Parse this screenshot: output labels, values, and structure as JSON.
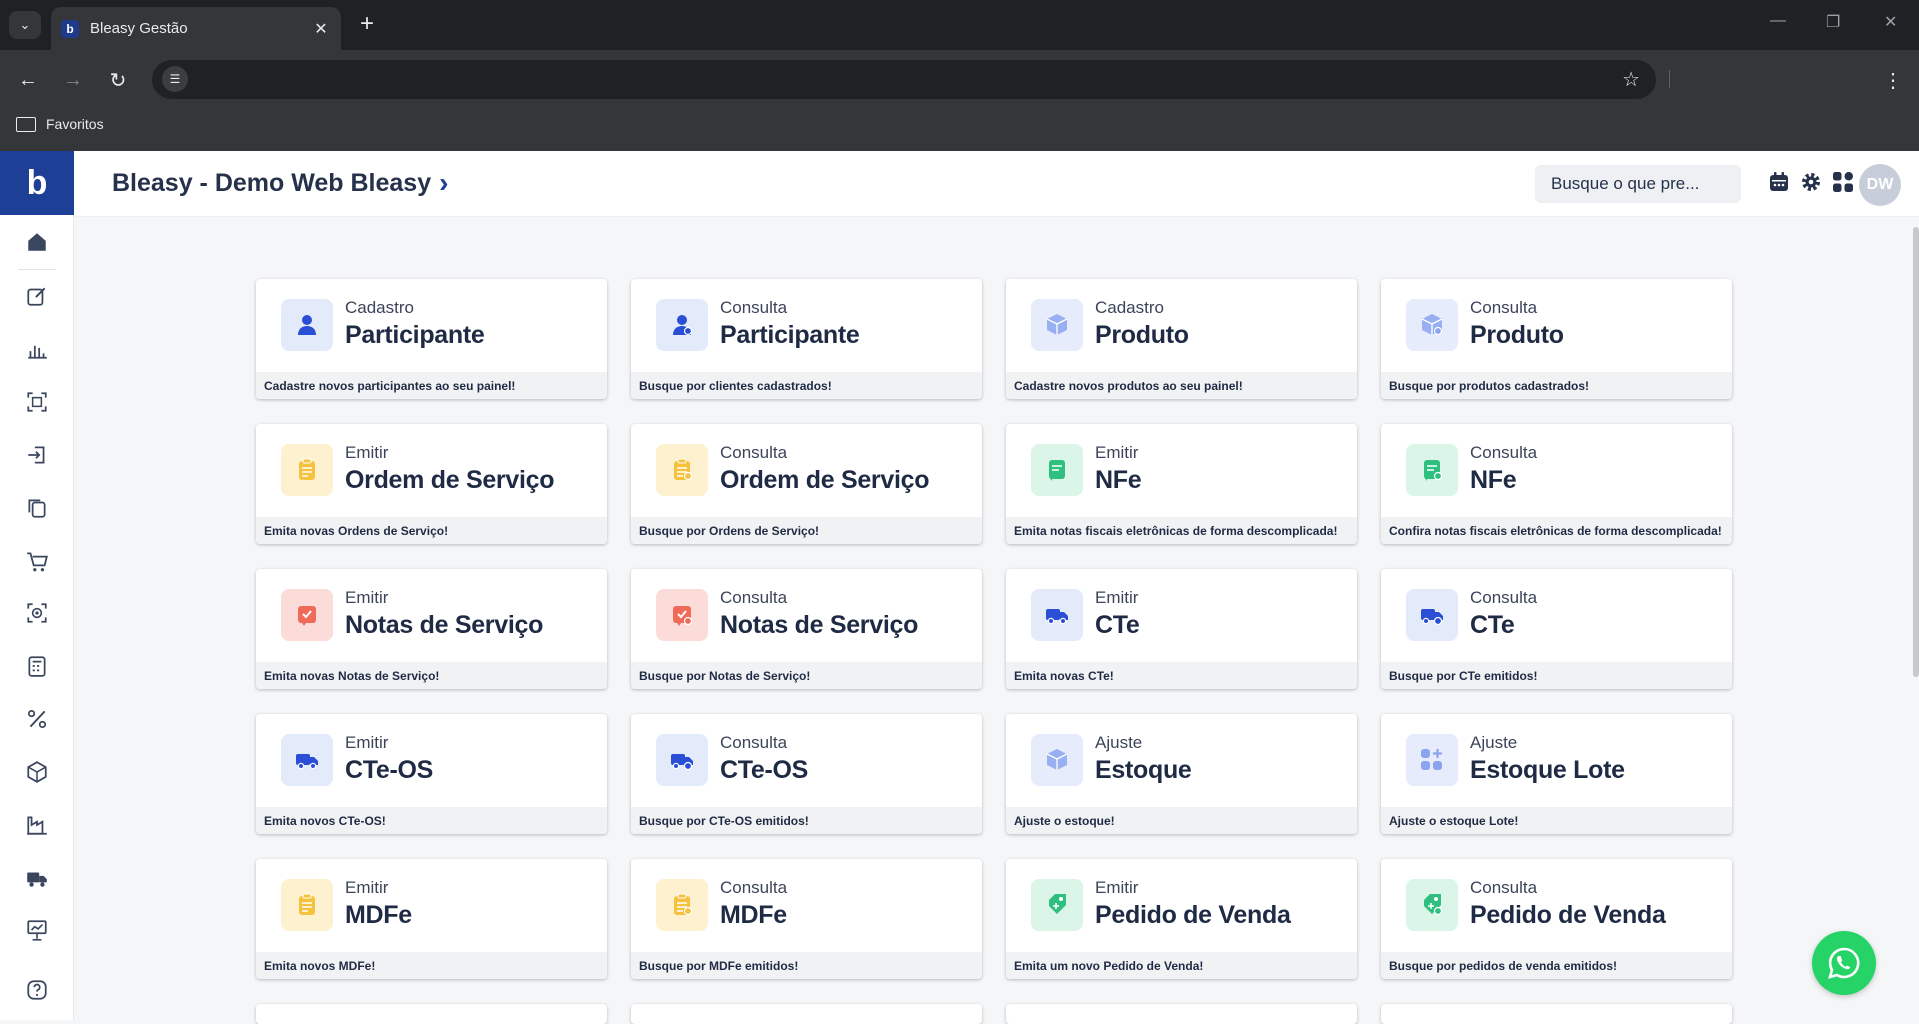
{
  "browser": {
    "tab_title": "Bleasy Gestão",
    "favicon_letter": "b",
    "bookmark_folder": "Favoritos"
  },
  "app": {
    "logo_letter": "b",
    "company": "Bleasy - Demo Web Bleasy",
    "search_placeholder": "Busque o que pre...",
    "avatar_initials": "DW"
  },
  "colors": {
    "brand": "#1e3f96",
    "blue_bg": "#e3ebfb",
    "blue_fg": "#2a4fd6",
    "yellow_bg": "#fdf1cf",
    "yellow_fg": "#f5c23e",
    "green_bg": "#dbf5e8",
    "green_fg": "#2fc07f",
    "red_bg": "#fbdcd8",
    "red_fg": "#f06a5a",
    "whatsapp": "#25d366"
  },
  "cards": [
    {
      "action": "Cadastro",
      "title": "Participante",
      "desc": "Cadastre novos participantes ao seu painel!",
      "icon": "user-add-icon",
      "tone": "blue"
    },
    {
      "action": "Consulta",
      "title": "Participante",
      "desc": "Busque por clientes cadastrados!",
      "icon": "user-search-icon",
      "tone": "blue"
    },
    {
      "action": "Cadastro",
      "title": "Produto",
      "desc": "Cadastre novos produtos ao seu painel!",
      "icon": "box-add-icon",
      "tone": "lightblue"
    },
    {
      "action": "Consulta",
      "title": "Produto",
      "desc": "Busque por produtos cadastrados!",
      "icon": "box-search-icon",
      "tone": "lightblue"
    },
    {
      "action": "Emitir",
      "title": "Ordem de Serviço",
      "desc": "Emita novas Ordens de Serviço!",
      "icon": "clipboard-icon",
      "tone": "yellow"
    },
    {
      "action": "Consulta",
      "title": "Ordem de Serviço",
      "desc": "Busque por Ordens de Serviço!",
      "icon": "clipboard-search-icon",
      "tone": "yellow"
    },
    {
      "action": "Emitir",
      "title": "NFe",
      "desc": "Emita notas fiscais eletrônicas de forma descomplicada!",
      "icon": "invoice-icon",
      "tone": "green"
    },
    {
      "action": "Consulta",
      "title": "NFe",
      "desc": "Confira notas fiscais eletrônicas de forma descomplicada!",
      "icon": "invoice-search-icon",
      "tone": "green"
    },
    {
      "action": "Emitir",
      "title": "Notas de Serviço",
      "desc": "Emita novas Notas de Serviço!",
      "icon": "service-note-icon",
      "tone": "red"
    },
    {
      "action": "Consulta",
      "title": "Notas de Serviço",
      "desc": "Busque por Notas de Serviço!",
      "icon": "service-note-search-icon",
      "tone": "red"
    },
    {
      "action": "Emitir",
      "title": "CTe",
      "desc": "Emita novas CTe!",
      "icon": "truck-icon",
      "tone": "blue"
    },
    {
      "action": "Consulta",
      "title": "CTe",
      "desc": "Busque por CTe emitidos!",
      "icon": "truck-search-icon",
      "tone": "blue"
    },
    {
      "action": "Emitir",
      "title": "CTe-OS",
      "desc": "Emita novos CTe-OS!",
      "icon": "truck-icon",
      "tone": "blue"
    },
    {
      "action": "Consulta",
      "title": "CTe-OS",
      "desc": "Busque por CTe-OS emitidos!",
      "icon": "truck-search-icon",
      "tone": "blue"
    },
    {
      "action": "Ajuste",
      "title": "Estoque",
      "desc": "Ajuste o estoque!",
      "icon": "box-adjust-icon",
      "tone": "lightblue"
    },
    {
      "action": "Ajuste",
      "title": "Estoque Lote",
      "desc": "Ajuste o estoque Lote!",
      "icon": "grid-add-icon",
      "tone": "lightblue"
    },
    {
      "action": "Emitir",
      "title": "MDFe",
      "desc": "Emita novos MDFe!",
      "icon": "clipboard-check-icon",
      "tone": "yellow"
    },
    {
      "action": "Consulta",
      "title": "MDFe",
      "desc": "Busque por MDFe emitidos!",
      "icon": "clipboard-check-search-icon",
      "tone": "yellow"
    },
    {
      "action": "Emitir",
      "title": "Pedido de Venda",
      "desc": "Emita um novo Pedido de Venda!",
      "icon": "tag-add-icon",
      "tone": "green"
    },
    {
      "action": "Consulta",
      "title": "Pedido de Venda",
      "desc": "Busque por pedidos de venda emitidos!",
      "icon": "tag-search-icon",
      "tone": "green"
    }
  ],
  "sidebar_icons": [
    "home-icon",
    "edit-icon",
    "chart-icon",
    "scan-icon",
    "login-icon",
    "copy-icon",
    "cart-icon",
    "target-icon",
    "calculator-icon",
    "percent-icon",
    "cube-icon",
    "factory-icon",
    "truck-icon",
    "presentation-icon",
    "help-icon"
  ]
}
